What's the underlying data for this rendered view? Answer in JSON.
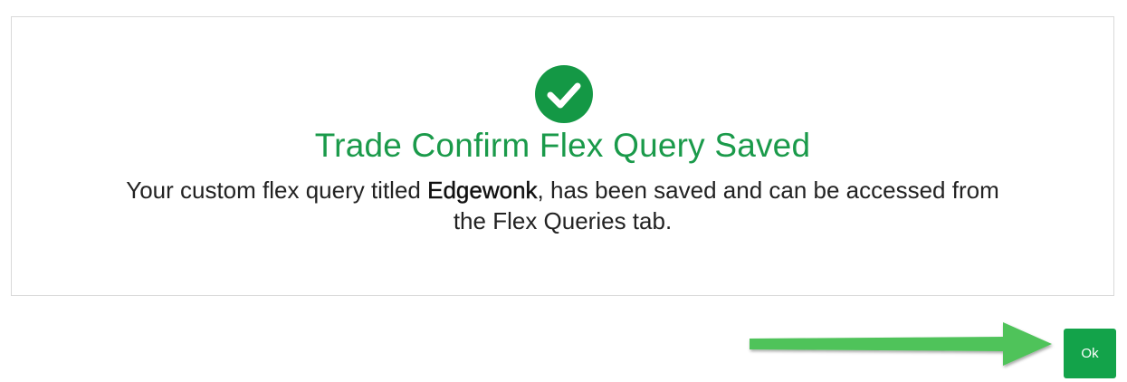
{
  "dialog": {
    "title": "Trade Confirm Flex Query Saved",
    "message_before": "Your custom flex query titled ",
    "query_name": "Edgewonk",
    "message_after": ", has been saved and can be accessed from the Flex Queries tab.",
    "icon": "check-circle-icon",
    "accent_color": "#1a9a4a"
  },
  "actions": {
    "ok_label": "Ok",
    "ok_color": "#13a34a"
  },
  "annotation": {
    "icon": "arrow-right-icon",
    "color": "#4fc35a"
  }
}
